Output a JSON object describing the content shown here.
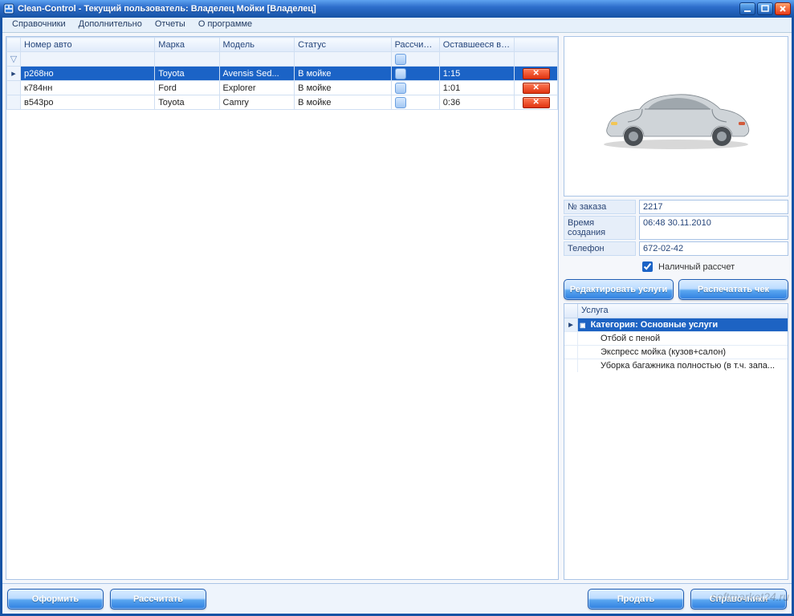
{
  "window": {
    "title": "Clean-Control - Текущий пользователь: Владелец Мойки [Владелец]"
  },
  "menu": {
    "items": [
      {
        "label": "Справочники"
      },
      {
        "label": "Дополнительно"
      },
      {
        "label": "Отчеты"
      },
      {
        "label": "О программе"
      }
    ]
  },
  "grid": {
    "columns": {
      "number": "Номер авто",
      "make": "Марка",
      "model": "Модель",
      "status": "Статус",
      "calc": "Рассчитан",
      "time": "Оставшееся время",
      "actions": ""
    },
    "rows": [
      {
        "number": "р268но",
        "make": "Toyota",
        "model": "Avensis Sed...",
        "status": "В мойке",
        "calc": true,
        "time": "1:15",
        "selected": true
      },
      {
        "number": "к784нн",
        "make": "Ford",
        "model": "Explorer",
        "status": "В мойке",
        "calc": true,
        "time": "1:01",
        "selected": false
      },
      {
        "number": "в543ро",
        "make": "Toyota",
        "model": "Camry",
        "status": "В мойке",
        "calc": true,
        "time": "0:36",
        "selected": false
      }
    ]
  },
  "order": {
    "labels": {
      "order_no": "№ заказа",
      "created": "Время создания",
      "phone": "Телефон",
      "cash": "Наличный рассчет"
    },
    "values": {
      "order_no": "2217",
      "created": "06:48 30.11.2010",
      "phone": "672-02-42"
    },
    "cash_checked": true,
    "buttons": {
      "edit": "Редактировать услуги",
      "print": "Распечатать чек"
    }
  },
  "services": {
    "column_label": "Услуга",
    "category_label": "Категория: Основные услуги",
    "items": [
      "Отбой с пеной",
      "Экспресс мойка (кузов+салон)",
      "Уборка багажника полностью (в т.ч. запа..."
    ]
  },
  "bottom": {
    "register": "Оформить",
    "calculate": "Рассчитать",
    "sell": "Продать",
    "dictionaries": "Справочники"
  },
  "watermark": "softmarket24.ru",
  "icons": {
    "delete_glyph": "✕"
  }
}
